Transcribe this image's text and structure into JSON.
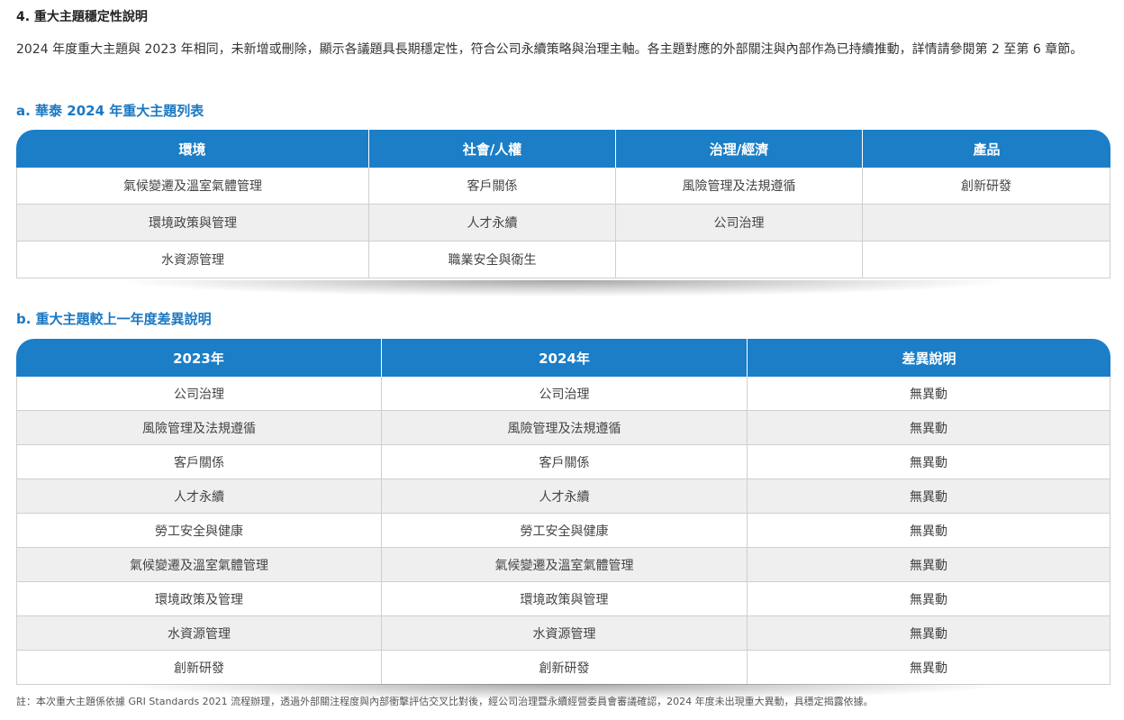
{
  "section_title": "4. 重大主題穩定性說明",
  "intro": "2024 年度重大主題與 2023 年相同，未新增或刪除，顯示各議題具長期穩定性，符合公司永續策略與治理主軸。各主題對應的外部關注與內部作為已持續推動，詳情請參閱第 2 至第 6 章節。",
  "table_a": {
    "title": "a. 華泰 2024 年重大主題列表",
    "headers": [
      "環境",
      "社會/人權",
      "治理/經濟",
      "產品"
    ],
    "rows": [
      [
        "氣候變遷及溫室氣體管理",
        "客戶關係",
        "風險管理及法規遵循",
        "創新研發"
      ],
      [
        "環境政策與管理",
        "人才永續",
        "公司治理",
        ""
      ],
      [
        "水資源管理",
        "職業安全與衛生",
        "",
        ""
      ]
    ]
  },
  "table_b": {
    "title": "b. 重大主題較上一年度差異說明",
    "headers": [
      "2023年",
      "2024年",
      "差異說明"
    ],
    "rows": [
      [
        "公司治理",
        "公司治理",
        "無異動"
      ],
      [
        "風險管理及法規遵循",
        "風險管理及法規遵循",
        "無異動"
      ],
      [
        "客戶關係",
        "客戶關係",
        "無異動"
      ],
      [
        "人才永續",
        "人才永續",
        "無異動"
      ],
      [
        "勞工安全與健康",
        "勞工安全與健康",
        "無異動"
      ],
      [
        "氣候變遷及溫室氣體管理",
        "氣候變遷及溫室氣體管理",
        "無異動"
      ],
      [
        "環境政策及管理",
        "環境政策與管理",
        "無異動"
      ],
      [
        "水資源管理",
        "水資源管理",
        "無異動"
      ],
      [
        "創新研發",
        "創新研發",
        "無異動"
      ]
    ]
  },
  "footnote": "註：本次重大主題係依據 GRI Standards 2021 流程辦理，透過外部關注程度與內部衝擊評估交叉比對後，經公司治理暨永續經營委員會審議確認，2024 年度未出現重大異動，具穩定揭露依據。"
}
